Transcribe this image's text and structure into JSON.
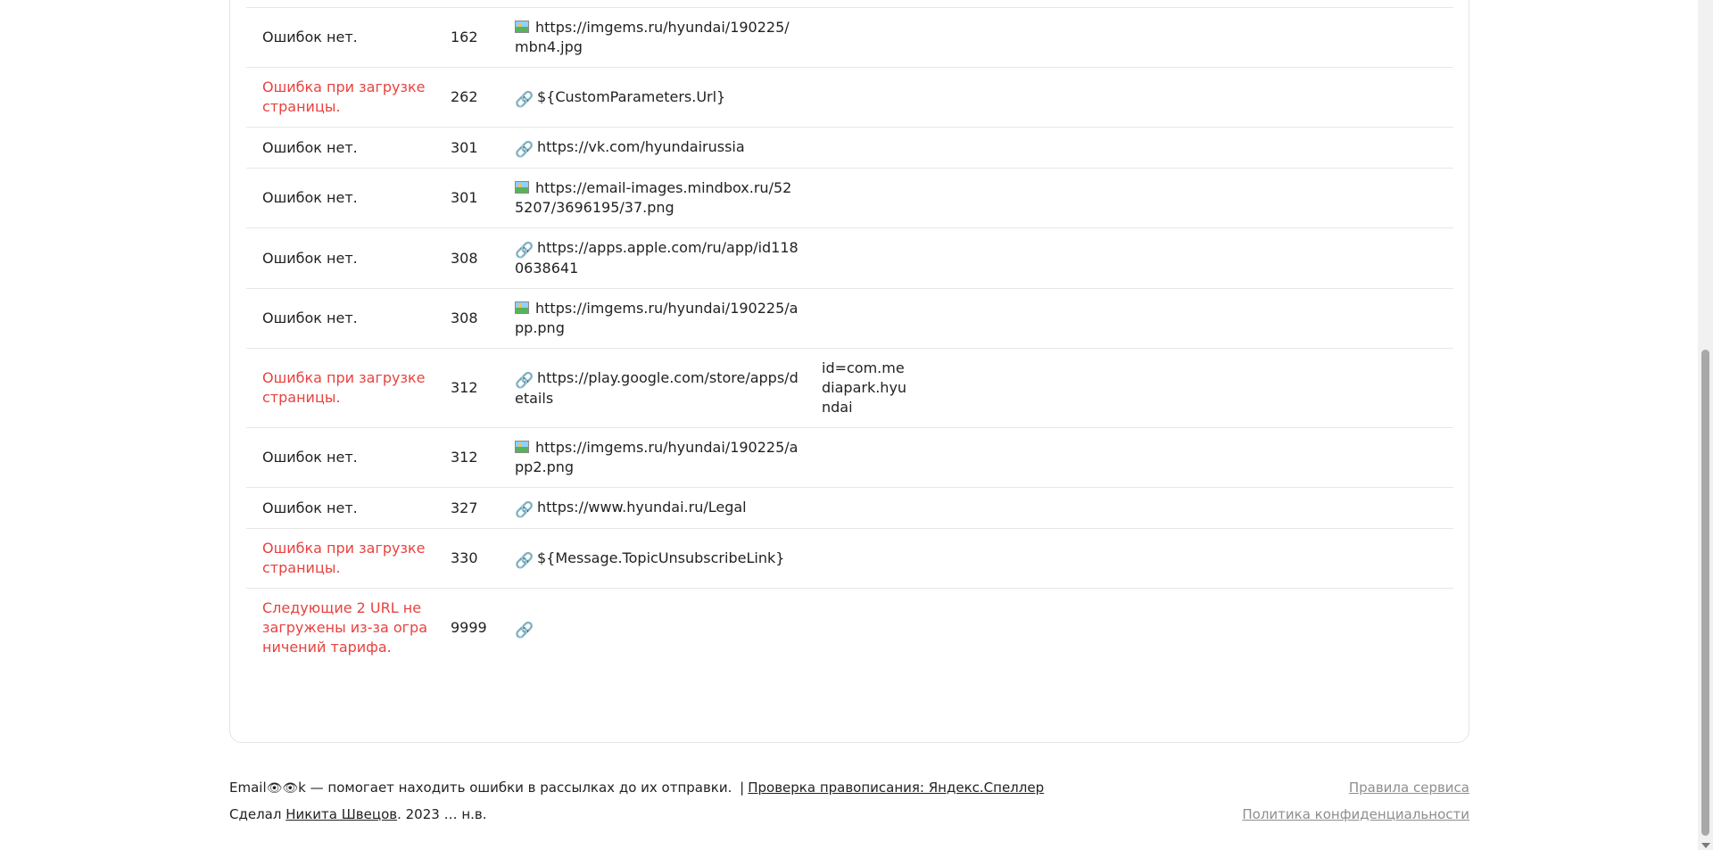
{
  "rows": [
    {
      "status": "Ошибок нет.",
      "error": false,
      "line": "162",
      "icon": "image-icon",
      "url": "https://imgems.ru/hyundai/190225/mbn4.jpg",
      "param": ""
    },
    {
      "status": "Ошибка при загрузке страницы.",
      "error": true,
      "line": "262",
      "icon": "link-icon",
      "url": "${CustomParameters.Url}",
      "param": ""
    },
    {
      "status": "Ошибок нет.",
      "error": false,
      "line": "301",
      "icon": "link-icon",
      "url": "https://vk.com/hyundairussia",
      "param": ""
    },
    {
      "status": "Ошибок нет.",
      "error": false,
      "line": "301",
      "icon": "image-icon",
      "url": "https://email-images.mindbox.ru/525207/3696195/37.png",
      "param": ""
    },
    {
      "status": "Ошибок нет.",
      "error": false,
      "line": "308",
      "icon": "link-icon",
      "url": "https://apps.apple.com/ru/app/id1180638641",
      "param": ""
    },
    {
      "status": "Ошибок нет.",
      "error": false,
      "line": "308",
      "icon": "image-icon",
      "url": "https://imgems.ru/hyundai/190225/app.png",
      "param": ""
    },
    {
      "status": "Ошибка при загрузке страницы.",
      "error": true,
      "line": "312",
      "icon": "link-icon",
      "url": "https://play.google.com/store/apps/details",
      "param": "id=com.mediapark.hyundai"
    },
    {
      "status": "Ошибок нет.",
      "error": false,
      "line": "312",
      "icon": "image-icon",
      "url": "https://imgems.ru/hyundai/190225/app2.png",
      "param": ""
    },
    {
      "status": "Ошибок нет.",
      "error": false,
      "line": "327",
      "icon": "link-icon",
      "url": "https://www.hyundai.ru/Legal",
      "param": ""
    },
    {
      "status": "Ошибка при загрузке страницы.",
      "error": true,
      "line": "330",
      "icon": "link-icon",
      "url": "${Message.TopicUnsubscribeLink}",
      "param": ""
    },
    {
      "status": "Следующие 2 URL не загружены из-за ограничений тарифа.",
      "error": true,
      "line": "9999",
      "icon": "link-icon",
      "url": "",
      "param": ""
    }
  ],
  "footer": {
    "brand_prefix": "Email",
    "brand_eyes": "👁👁",
    "brand_suffix": "k",
    "tagline": " — помогает находить ошибки в рассылках до их отправки.",
    "separator": "|",
    "speller_link": "Проверка правописания: Яндекс.Спеллер",
    "made_by_prefix": "Сделал ",
    "author_link": "Никита Швецов",
    "made_by_suffix": ". 2023 … н.в.",
    "rules_link": "Правила сервиса",
    "privacy_link": "Политика конфиденциальности"
  },
  "colors": {
    "error": "#e8423f",
    "text": "#222222",
    "muted_link": "#8e8e8e"
  }
}
